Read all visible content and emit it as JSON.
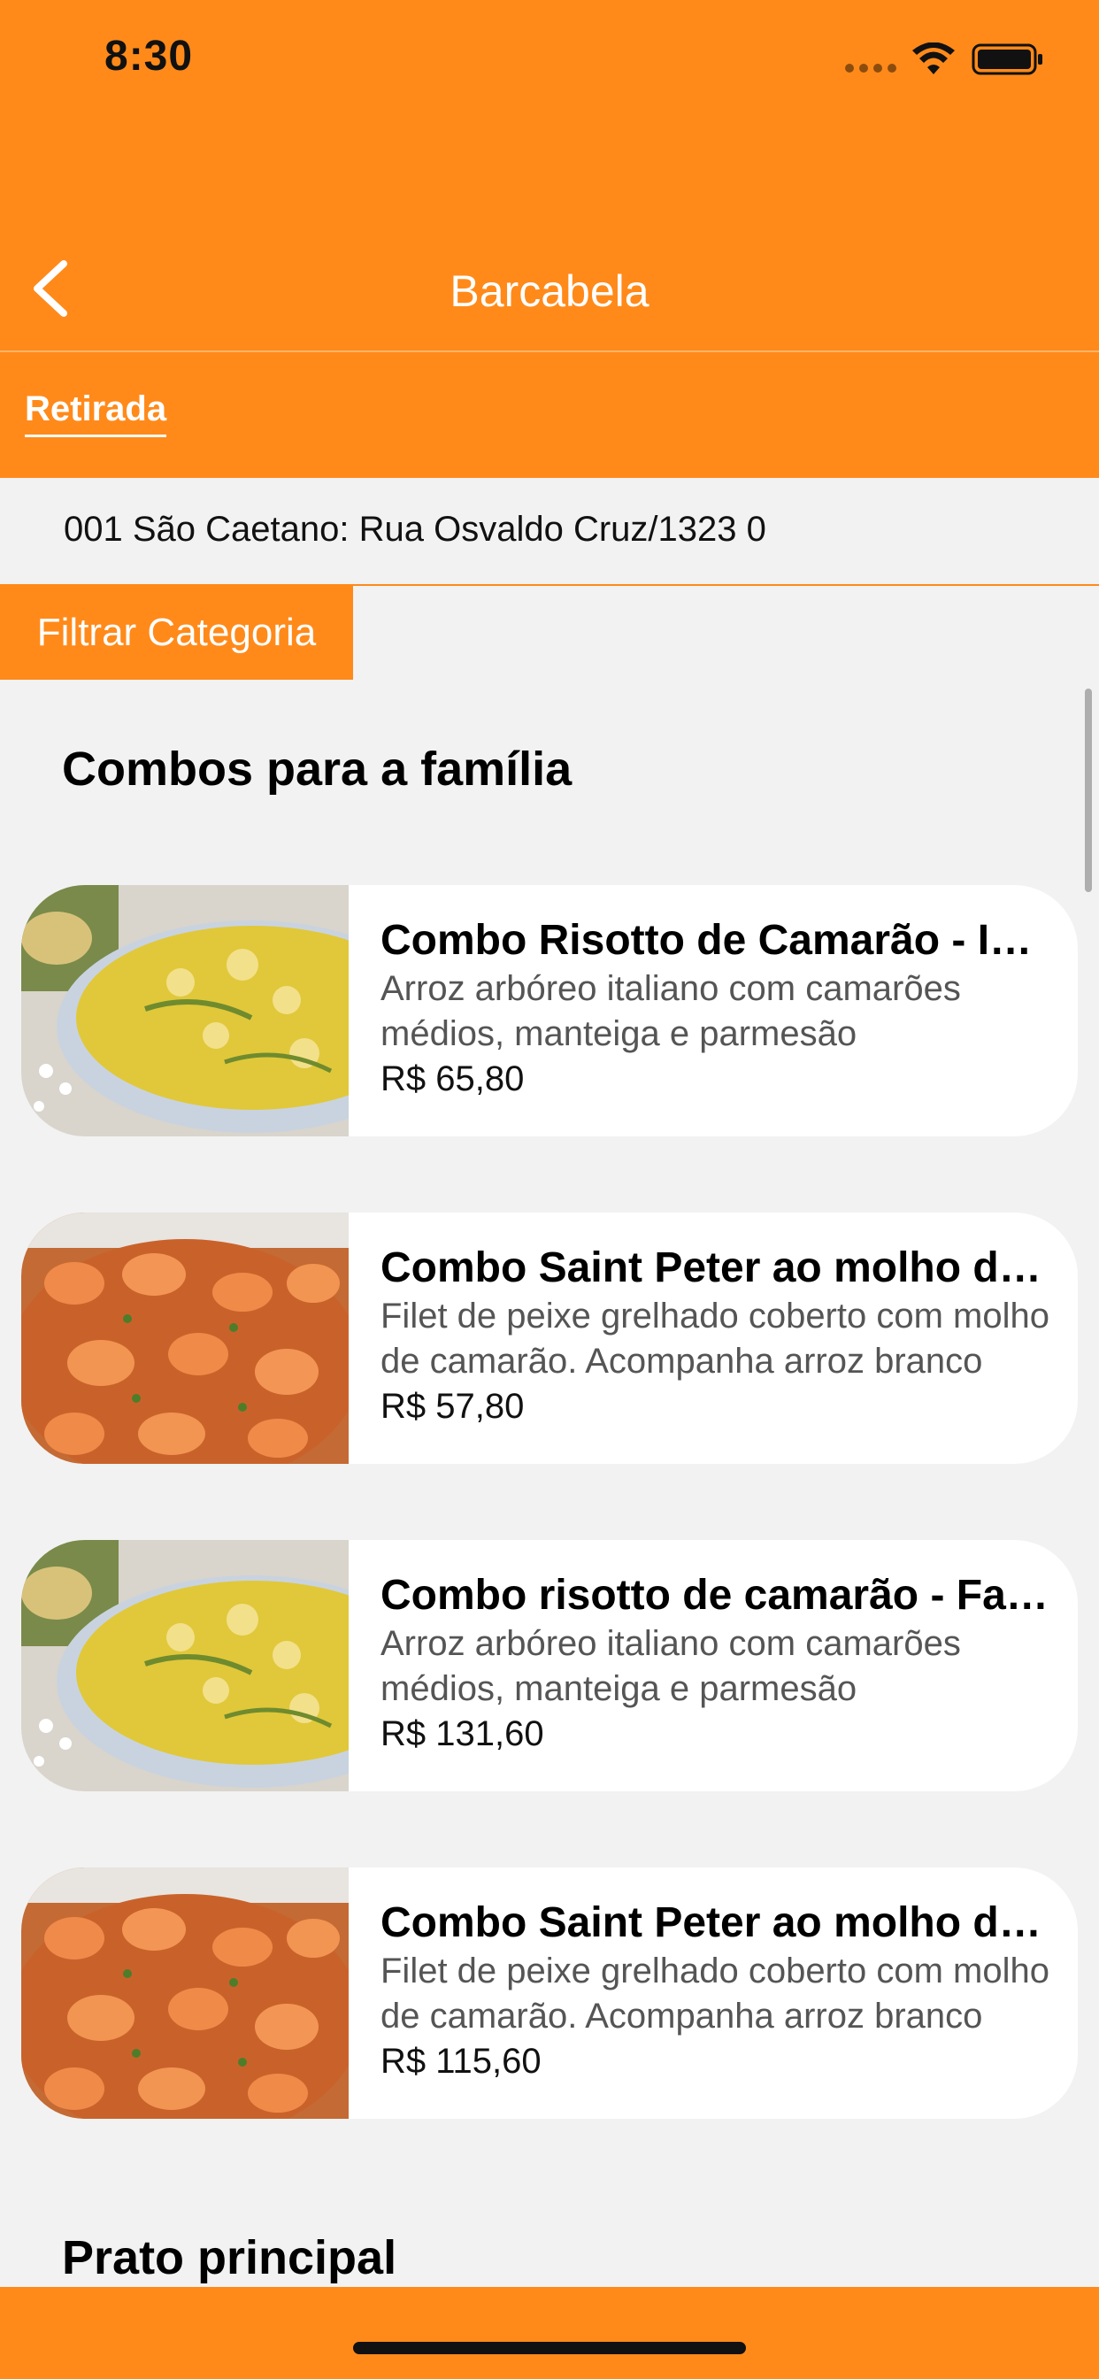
{
  "status_bar": {
    "time": "8:30"
  },
  "nav": {
    "title": "Barcabela",
    "back_icon": "chevron-left-icon"
  },
  "delivery_mode": {
    "tab_label": "Retirada"
  },
  "store": {
    "label": "001 São Caetano: Rua Osvaldo Cruz/1323 0"
  },
  "filter": {
    "label": "Filtrar Categoria"
  },
  "sections": [
    {
      "title": "Combos para a família",
      "items": [
        {
          "title": "Combo Risotto de Camarão - Individual",
          "description": "Arroz arbóreo italiano com camarões médios, manteiga e parmesão",
          "price": "R$ 65,80",
          "image": "risotto-photo"
        },
        {
          "title": "Combo Saint Peter ao molho de camarão",
          "description": "Filet de peixe grelhado coberto com molho de camarão. Acompanha arroz branco",
          "price": "R$ 57,80",
          "image": "shrimp-sauce-photo"
        },
        {
          "title": "Combo risotto de camarão - Família",
          "description": "Arroz arbóreo italiano com camarões médios, manteiga e parmesão",
          "price": "R$ 131,60",
          "image": "risotto-photo"
        },
        {
          "title": "Combo Saint Peter ao molho de camarão",
          "description": "Filet de peixe grelhado coberto com molho de camarão. Acompanha arroz branco",
          "price": "R$ 115,60",
          "image": "shrimp-sauce-photo"
        }
      ]
    },
    {
      "title": "Prato principal",
      "items": []
    }
  ],
  "colors": {
    "brand_orange": "#ff8a1a",
    "background": "#f2f2f2",
    "card": "#ffffff"
  }
}
